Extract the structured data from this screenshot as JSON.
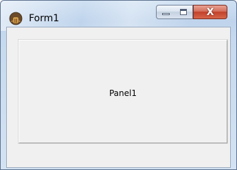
{
  "window": {
    "title": "Form1",
    "icon": "delphi-app-icon",
    "buttons": {
      "minimize_icon": "minimize-icon",
      "maximize_icon": "maximize-icon",
      "close_label": "X"
    }
  },
  "panel": {
    "caption": "Panel1"
  },
  "colors": {
    "titlebar": "#c6d9ee",
    "client_background": "#f0f0f0",
    "close_button": "#c2402a"
  }
}
